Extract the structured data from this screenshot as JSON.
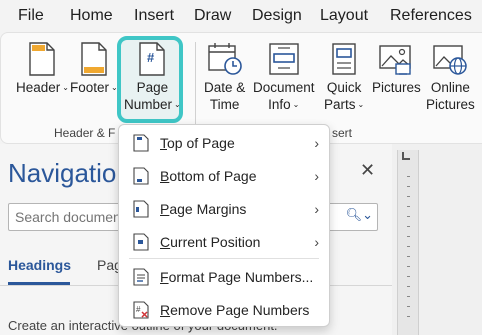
{
  "menubar": {
    "tabs": [
      "File",
      "Home",
      "Insert",
      "Draw",
      "Design",
      "Layout",
      "References"
    ]
  },
  "ribbon": {
    "header": {
      "line1": "Header",
      "line2": ""
    },
    "footer": {
      "line1": "Footer",
      "line2": ""
    },
    "page_number": {
      "line1": "Page",
      "line2": "Number"
    },
    "date_time": {
      "line1": "Date &",
      "line2": "Time"
    },
    "document_info": {
      "line1": "Document",
      "line2": "Info"
    },
    "quick_parts": {
      "line1": "Quick",
      "line2": "Parts"
    },
    "pictures": {
      "line1": "Pictures",
      "line2": ""
    },
    "online_pictures": {
      "line1": "Online",
      "line2": "Pictures"
    },
    "group_header_footer": "Header & F",
    "group_insert": "sert",
    "accent": "#3fc6c6"
  },
  "navigation": {
    "title": "Navigatio",
    "search_placeholder": "Search document",
    "tab_headings": "Headings",
    "tab_pages": "Pag",
    "hint": "Create an interactive outline of your document."
  },
  "dropdown": {
    "items": [
      {
        "accel": "T",
        "rest": "op of Page",
        "has_submenu": true,
        "icon": "page-top-icon"
      },
      {
        "accel": "B",
        "rest": "ottom of Page",
        "has_submenu": true,
        "icon": "page-bottom-icon"
      },
      {
        "accel": "P",
        "rest": "age Margins",
        "has_submenu": true,
        "icon": "page-margins-icon"
      },
      {
        "accel": "C",
        "rest": "urrent Position",
        "has_submenu": true,
        "icon": "current-position-icon"
      },
      {
        "accel": "F",
        "rest": "ormat Page Numbers...",
        "has_submenu": false,
        "icon": "format-page-numbers-icon"
      },
      {
        "accel": "R",
        "rest": "emove Page Numbers",
        "has_submenu": false,
        "icon": "remove-page-numbers-icon"
      }
    ]
  },
  "colors": {
    "brand_blue": "#2b579a",
    "highlight": "#3fc6c6"
  }
}
